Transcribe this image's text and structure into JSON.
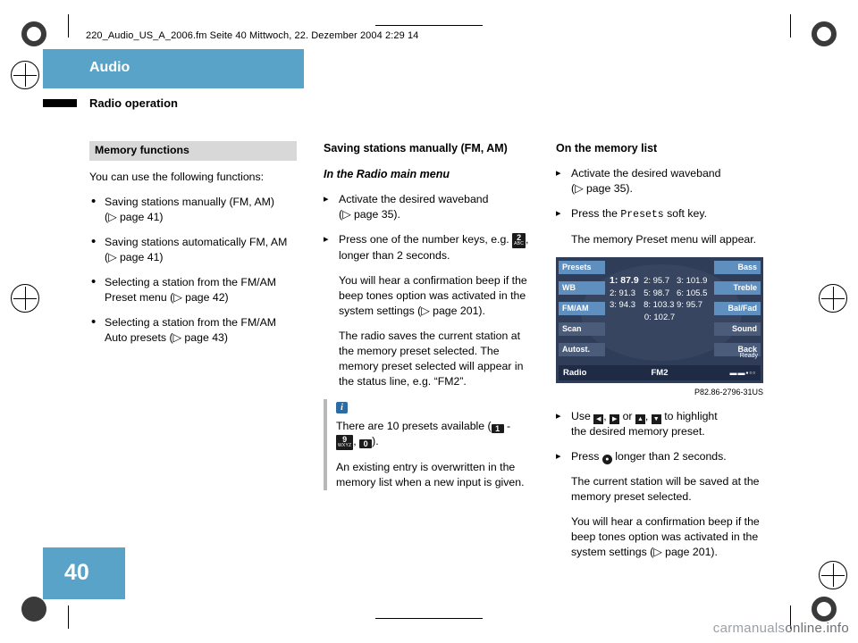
{
  "header": {
    "file_info": "220_Audio_US_A_2006.fm  Seite 40  Mittwoch, 22. Dezember 2004  2:29 14",
    "chapter": "Audio",
    "section": "Radio operation",
    "page_number": "40"
  },
  "col1": {
    "box_heading": "Memory functions",
    "intro": "You can use the following functions:",
    "items": [
      "Saving stations manually (FM, AM) (▷ page 41)",
      "Saving stations automatically FM, AM (▷ page 41)",
      "Selecting a station from the FM/AM Preset menu (▷ page 42)",
      "Selecting a station from the FM/AM Auto presets (▷ page 43)"
    ],
    "item_lines": [
      [
        "Saving stations manually (FM, AM)",
        "(▷ page 41)"
      ],
      [
        "Saving stations automatically FM, AM",
        "(▷ page 41)"
      ],
      [
        "Selecting a station from the FM/AM",
        "Preset menu (▷ page 42)"
      ],
      [
        "Selecting a station from the FM/AM",
        "Auto presets (▷ page 43)"
      ]
    ]
  },
  "col2": {
    "heading": "Saving stations manually (FM, AM)",
    "subheading": "In the Radio main menu",
    "step1_line1": "Activate the desired waveband",
    "step1_line2": "(▷ page 35).",
    "step2_line1": "Press one of the number keys, e.g.",
    "step2_key_big": "2",
    "step2_key_sm": "ABC",
    "step2_line2": "longer than 2 seconds.",
    "para1": "You will hear a confirmation beep if the beep tones option was activated in the system settings (▷ page 201).",
    "para2": "The radio saves the current station at the memory preset selected. The memory preset selected will appear in the status line, e.g. “FM2”.",
    "note_line1_a": "There are 10 presets available (",
    "note_key1": "1",
    "note_line1_b": " -",
    "note_key2_big": "9",
    "note_key2_sm": "WXYZ",
    "note_key3": "0",
    "note_line1_c": ").",
    "note_para2": "An existing entry is overwritten in the memory list when a new input is given."
  },
  "col3": {
    "heading": "On the memory list",
    "step1_line1": "Activate the desired waveband",
    "step1_line2": "(▷ page 35).",
    "step2_pre": "Press the",
    "step2_key": "Presets",
    "step2_post": "soft key.",
    "step2_para": "The memory Preset menu will appear.",
    "figure_caption": "P82.86-2796-31US",
    "step3_pre": "Use",
    "step3_post": "to highlight the desired memory preset.",
    "step3_line2": "the desired memory preset.",
    "step3_or": "or",
    "step4_pre": "Press",
    "step4_post": "longer than 2 seconds.",
    "para_after_4": "The current station will be saved at the memory preset selected.",
    "para_last": "You will hear a confirmation beep if the beep tones option was activated in the system settings (▷ page 201)."
  },
  "figure": {
    "softkeys_left": [
      "Presets",
      "WB",
      "FM/AM",
      "Scan",
      "Autost."
    ],
    "softkeys_right": [
      "Bass",
      "Treble",
      "Bal/Fad",
      "Sound",
      "Back"
    ],
    "presets": [
      [
        "1: 87.9",
        "2:   95.7",
        "3: 101.9"
      ],
      [
        "2: 91.3",
        "5:   98.7",
        "6: 105.5"
      ],
      [
        "3: 94.3",
        "8: 103.3",
        "9:   95.7"
      ]
    ],
    "preset_center": "0: 102.7",
    "highlight_text": "87.9",
    "ready_label": "Ready",
    "status_left": "Radio",
    "status_center": "FM2",
    "status_signal": "▬▬▪▫▫"
  },
  "watermark": {
    "text_a": "carmanuals",
    "text_b": "online.info"
  },
  "colors": {
    "accent": "#59a3c8",
    "display_bg": "#2f3d59",
    "softkey": "#4b5c7a",
    "softkey_selected": "#5e8fbf",
    "status_bar": "#1f2b45",
    "box_heading_bg": "#d8d8d8",
    "note_bar": "#b8b8b8",
    "info_icon": "#2b6ca3"
  }
}
